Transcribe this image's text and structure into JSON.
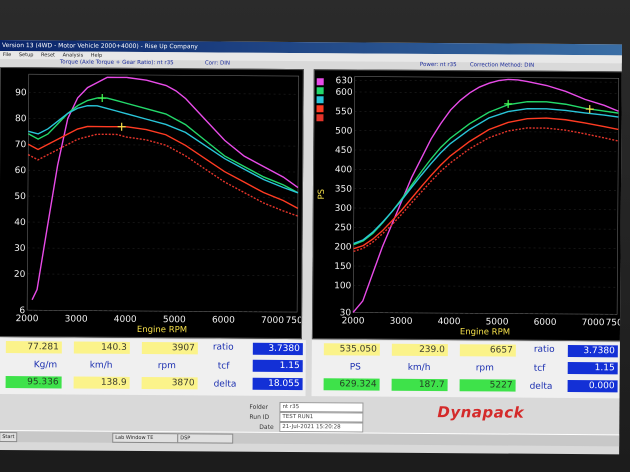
{
  "window": {
    "title": "Version 13 (4WD - Motor Vehicle 2000+4000) - Rise Up Company",
    "menu": [
      "File",
      "Setup",
      "Reset",
      "Analysis",
      "Help"
    ]
  },
  "left_header": {
    "torque_label": "Torque (Axle Torque + Gear Ratio): nt r35",
    "corr": "Corr: DIN"
  },
  "right_header": {
    "power_label": "Power: nt r35",
    "corr": "Correction Method: DIN"
  },
  "chart_data": [
    {
      "type": "line",
      "xlabel": "Engine RPM",
      "ylabel": "",
      "xlim": [
        2000,
        7500
      ],
      "ylim": [
        6,
        97
      ],
      "x_ticks": [
        "2000",
        "3000",
        "4000",
        "5000",
        "6000",
        "7000",
        "7500"
      ],
      "y_ticks": [
        "6",
        "20",
        "30",
        "40",
        "50",
        "60",
        "70",
        "80",
        "90"
      ],
      "markers": [
        {
          "x": 3500,
          "y": 88
        },
        {
          "x": 3900,
          "y": 77
        }
      ],
      "series": [
        {
          "color": "#e84be8",
          "x": [
            2100,
            2200,
            2400,
            2600,
            2800,
            3000,
            3200,
            3400,
            3600,
            3800,
            4000,
            4400,
            4800,
            5000,
            5200,
            5600,
            6000,
            6400,
            6800,
            7200,
            7500
          ],
          "y": [
            10,
            14,
            38,
            62,
            80,
            88,
            92,
            94,
            96,
            96,
            96,
            95,
            93,
            91,
            88,
            80,
            72,
            66,
            62,
            58,
            54
          ]
        },
        {
          "color": "#23d86a",
          "x": [
            2000,
            2200,
            2400,
            2600,
            2800,
            3000,
            3200,
            3400,
            3600,
            3800,
            4000,
            4400,
            4800,
            5200,
            5600,
            6000,
            6400,
            6800,
            7200,
            7500
          ],
          "y": [
            74,
            72,
            74,
            78,
            82,
            85,
            87,
            88,
            88,
            87,
            86,
            84,
            82,
            78,
            72,
            66,
            62,
            58,
            55,
            52
          ]
        },
        {
          "color": "#29c5d9",
          "x": [
            2000,
            2200,
            2400,
            2600,
            2800,
            3000,
            3200,
            3400,
            3600,
            3800,
            4000,
            4400,
            4800,
            5200,
            5600,
            6000,
            6400,
            6800,
            7200,
            7500
          ],
          "y": [
            75,
            74,
            76,
            79,
            82,
            84,
            85,
            85,
            84,
            83,
            82,
            80,
            78,
            75,
            70,
            65,
            61,
            57,
            54,
            52
          ]
        },
        {
          "color": "#ff3b22",
          "x": [
            2000,
            2200,
            2400,
            2600,
            2800,
            3000,
            3200,
            3400,
            3600,
            3800,
            4000,
            4400,
            4800,
            5200,
            5600,
            6000,
            6400,
            6800,
            7200,
            7500
          ],
          "y": [
            70,
            68,
            70,
            72,
            74,
            76,
            77,
            77,
            77,
            77,
            77,
            76,
            74,
            70,
            65,
            60,
            56,
            52,
            49,
            46
          ]
        },
        {
          "color": "#e3342a",
          "dashed": true,
          "x": [
            2000,
            2200,
            2400,
            2600,
            2800,
            3000,
            3200,
            3400,
            3600,
            3800,
            4000,
            4400,
            4800,
            5200,
            5600,
            6000,
            6400,
            6800,
            7200,
            7500
          ],
          "y": [
            66,
            64,
            66,
            68,
            70,
            72,
            73,
            74,
            74,
            74,
            73,
            72,
            70,
            66,
            61,
            56,
            52,
            48,
            45,
            43
          ]
        }
      ]
    },
    {
      "type": "line",
      "xlabel": "Engine RPM",
      "ylabel": "PS",
      "xlim": [
        2000,
        7500
      ],
      "ylim": [
        30,
        640
      ],
      "x_ticks": [
        "2000",
        "3000",
        "4000",
        "5000",
        "6000",
        "7000",
        "7500"
      ],
      "y_ticks": [
        "30",
        "100",
        "150",
        "200",
        "250",
        "300",
        "350",
        "400",
        "450",
        "500",
        "550",
        "600",
        "630"
      ],
      "markers": [
        {
          "x": 5200,
          "y": 572
        },
        {
          "x": 6900,
          "y": 560
        }
      ],
      "series": [
        {
          "color": "#e84be8",
          "x": [
            2000,
            2200,
            2400,
            2600,
            2800,
            3000,
            3200,
            3400,
            3600,
            3800,
            4000,
            4200,
            4400,
            4600,
            4800,
            5000,
            5200,
            5400,
            5600,
            6000,
            6400,
            6800,
            7200,
            7500
          ],
          "y": [
            30,
            60,
            130,
            200,
            260,
            320,
            380,
            430,
            480,
            520,
            555,
            580,
            600,
            615,
            625,
            632,
            635,
            634,
            630,
            620,
            605,
            585,
            570,
            555
          ]
        },
        {
          "color": "#23d86a",
          "x": [
            2000,
            2200,
            2400,
            2600,
            2800,
            3000,
            3200,
            3400,
            3600,
            3800,
            4000,
            4400,
            4800,
            5200,
            5600,
            6000,
            6400,
            6800,
            7200,
            7500
          ],
          "y": [
            205,
            215,
            235,
            262,
            292,
            325,
            360,
            395,
            428,
            458,
            482,
            520,
            550,
            570,
            578,
            578,
            572,
            562,
            555,
            550
          ]
        },
        {
          "color": "#29c5d9",
          "x": [
            2000,
            2200,
            2400,
            2600,
            2800,
            3000,
            3200,
            3400,
            3600,
            3800,
            4000,
            4400,
            4800,
            5200,
            5600,
            6000,
            6400,
            6800,
            7200,
            7500
          ],
          "y": [
            208,
            218,
            238,
            264,
            292,
            322,
            354,
            386,
            416,
            444,
            468,
            505,
            535,
            552,
            560,
            560,
            556,
            550,
            545,
            540
          ]
        },
        {
          "color": "#ff3b22",
          "x": [
            2000,
            2200,
            2400,
            2600,
            2800,
            3000,
            3200,
            3400,
            3600,
            3800,
            4000,
            4400,
            4800,
            5200,
            5600,
            6000,
            6400,
            6800,
            7200,
            7500
          ],
          "y": [
            195,
            203,
            220,
            242,
            268,
            296,
            326,
            356,
            385,
            412,
            436,
            474,
            505,
            524,
            534,
            536,
            532,
            524,
            515,
            508
          ]
        },
        {
          "color": "#e3342a",
          "dashed": true,
          "x": [
            2000,
            2200,
            2400,
            2600,
            2800,
            3000,
            3200,
            3400,
            3600,
            3800,
            4000,
            4400,
            4800,
            5200,
            5600,
            6000,
            6400,
            6800,
            7200,
            7500
          ],
          "y": [
            188,
            196,
            212,
            234,
            258,
            285,
            314,
            342,
            370,
            396,
            418,
            455,
            484,
            502,
            510,
            510,
            505,
            496,
            486,
            478
          ]
        }
      ]
    }
  ],
  "left_stats": {
    "top": [
      "77.281",
      "140.3",
      "3907"
    ],
    "units": [
      "Kg/m",
      "km/h",
      "rpm"
    ],
    "bottom": [
      "95.336",
      "138.9",
      "3870"
    ],
    "ratio_label": "ratio",
    "ratio": "3.7380",
    "tcf_label": "tcf",
    "tcf": "1.15",
    "delta_label": "delta",
    "delta": "18.055"
  },
  "right_stats": {
    "top": [
      "535.050",
      "239.0",
      "6657"
    ],
    "units": [
      "PS",
      "km/h",
      "rpm"
    ],
    "bottom": [
      "629.324",
      "187.7",
      "5227"
    ],
    "ratio_label": "ratio",
    "ratio": "3.7380",
    "tcf_label": "tcf",
    "tcf": "1.15",
    "delta_label": "delta",
    "delta": "0.000"
  },
  "run_info": {
    "folder_label": "Folder",
    "folder": "nt r35",
    "runid_label": "Run ID",
    "runid": "TEST RUN1",
    "date_label": "Date",
    "date": "21-Jul-2021 15:20:28"
  },
  "logo": "Dynapack",
  "taskbar": {
    "start": "Start",
    "items": [
      "Lab Window TE",
      "DSP"
    ]
  }
}
